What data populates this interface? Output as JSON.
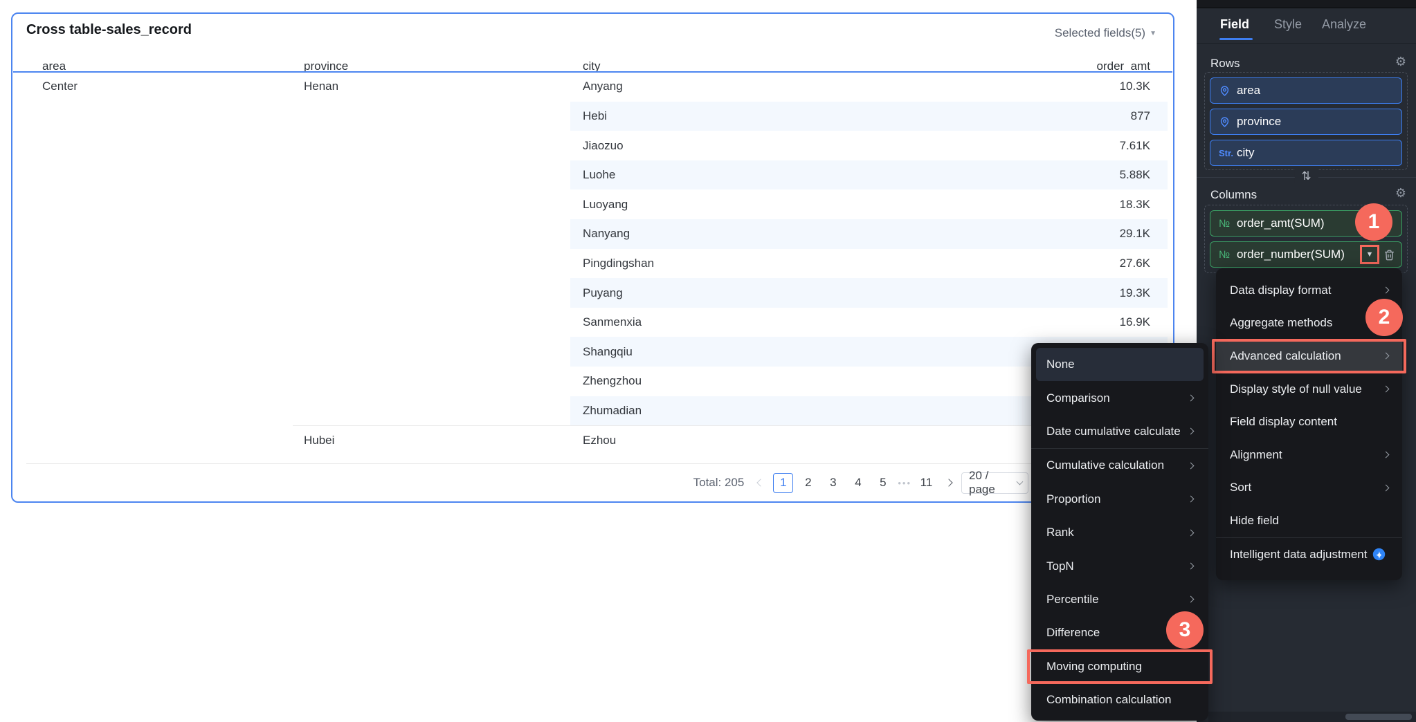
{
  "table": {
    "title": "Cross table-sales_record",
    "selected_fields": "Selected fields(5)",
    "columns": [
      "area",
      "province",
      "city",
      "order_amt"
    ],
    "rows": [
      {
        "area": "Center",
        "province": "Henan",
        "city": "Anyang",
        "value": "10.3K"
      },
      {
        "city": "Hebi",
        "value": "877"
      },
      {
        "city": "Jiaozuo",
        "value": "7.61K"
      },
      {
        "city": "Luohe",
        "value": "5.88K"
      },
      {
        "city": "Luoyang",
        "value": "18.3K"
      },
      {
        "city": "Nanyang",
        "value": "29.1K"
      },
      {
        "city": "Pingdingshan",
        "value": "27.6K"
      },
      {
        "city": "Puyang",
        "value": "19.3K"
      },
      {
        "city": "Sanmenxia",
        "value": "16.9K"
      },
      {
        "city": "Shangqiu",
        "value": ""
      },
      {
        "city": "Zhengzhou",
        "value": ""
      },
      {
        "city": "Zhumadian",
        "value": ""
      },
      {
        "province": "Hubei",
        "city": "Ezhou",
        "value": "",
        "divider_above": true
      }
    ],
    "pagination": {
      "total_label": "Total: 205",
      "pages": [
        "1",
        "2",
        "3",
        "4",
        "5",
        "•••",
        "11"
      ],
      "active_page": "1",
      "page_size_label": "20 / page"
    }
  },
  "panel": {
    "tabs": [
      {
        "label": "Field",
        "active": true
      },
      {
        "label": "Style",
        "active": false
      },
      {
        "label": "Analyze",
        "active": false
      }
    ],
    "rows_section": {
      "label": "Rows",
      "chips": [
        {
          "icon": "pin",
          "label": "area"
        },
        {
          "icon": "pin",
          "label": "province"
        },
        {
          "icon": "string",
          "label": "city"
        }
      ]
    },
    "columns_section": {
      "label": "Columns",
      "chips": [
        {
          "icon": "numeric",
          "label": "order_amt(SUM)"
        },
        {
          "icon": "numeric",
          "label": "order_number(SUM)",
          "caret_annotated": true,
          "trash": true
        }
      ]
    }
  },
  "field_menu": {
    "items": [
      {
        "label": "Data display format",
        "has_submenu": true
      },
      {
        "label": "Aggregate methods"
      },
      {
        "label": "Advanced calculation",
        "has_submenu": true,
        "highlighted": true
      },
      {
        "label": "Display style of null value",
        "has_submenu": true
      },
      {
        "label": "Field display content"
      },
      {
        "label": "Alignment",
        "has_submenu": true
      },
      {
        "label": "Sort",
        "has_submenu": true
      },
      {
        "label": "Hide field"
      },
      {
        "label": "Intelligent data adjustment",
        "divider_before": true,
        "icon": "ai"
      }
    ]
  },
  "advanced_menu": {
    "items": [
      {
        "label": "None",
        "selected": true
      },
      {
        "label": "Comparison",
        "has_submenu": true
      },
      {
        "label": "Date cumulative calculate",
        "has_submenu": true
      },
      {
        "label": "Cumulative calculation",
        "has_submenu": true,
        "divider_before": true
      },
      {
        "label": "Proportion",
        "has_submenu": true
      },
      {
        "label": "Rank",
        "has_submenu": true
      },
      {
        "label": "TopN",
        "has_submenu": true
      },
      {
        "label": "Percentile",
        "has_submenu": true
      },
      {
        "label": "Difference"
      },
      {
        "label": "Moving computing",
        "highlighted": true
      },
      {
        "label": "Combination calculation"
      }
    ]
  },
  "badges": [
    {
      "label": "1"
    },
    {
      "label": "2"
    },
    {
      "label": "3"
    }
  ],
  "icons": {
    "gear": "⚙",
    "swap": "⇅",
    "caret_down": "▼",
    "numeric": "№",
    "string": "Str."
  },
  "colors": {
    "accent_blue": "#3d7ef0",
    "dimension_blue": "#4f8bff",
    "measure_green": "#3ba064",
    "annotation_red": "#f5695c",
    "row_stripe": "#f3f8fe",
    "panel_bg": "#262b33",
    "menu_bg": "#17181c"
  }
}
